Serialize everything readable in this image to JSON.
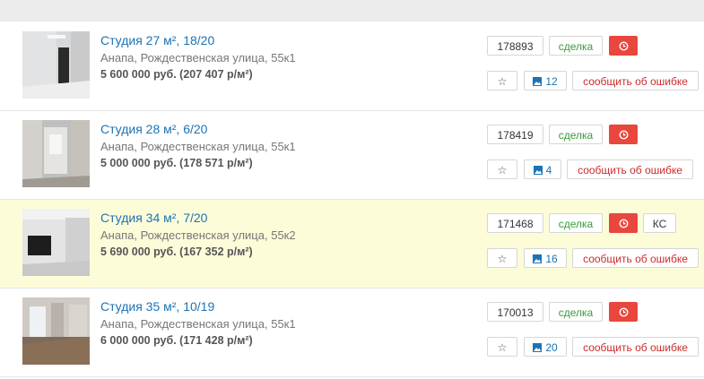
{
  "listings": [
    {
      "title": "Студия 27 м², 18/20",
      "address": "Анапа, Рождественская улица, 55к1",
      "price": "5 600 000 руб. (207 407 р/м²)",
      "id": "178893",
      "status": "сделка",
      "photo_count": "12",
      "report": "сообщить об ошибке"
    },
    {
      "title": "Студия 28 м², 6/20",
      "address": "Анапа, Рождественская улица, 55к1",
      "price": "5 000 000 руб. (178 571 р/м²)",
      "id": "178419",
      "status": "сделка",
      "photo_count": "4",
      "report": "сообщить об ошибке"
    },
    {
      "title": "Студия 34 м², 7/20",
      "address": "Анапа, Рождественская улица, 55к2",
      "price": "5 690 000 руб. (167 352 р/м²)",
      "id": "171468",
      "status": "сделка",
      "tag": "КС",
      "photo_count": "16",
      "report": "сообщить об ошибке"
    },
    {
      "title": "Студия 35 м², 10/19",
      "address": "Анапа, Рождественская улица, 55к1",
      "price": "6 000 000 руб. (171 428 р/м²)",
      "id": "170013",
      "status": "сделка",
      "photo_count": "20",
      "report": "сообщить об ошибке"
    }
  ],
  "icons": {
    "star": "star-icon",
    "photo": "image-icon",
    "clock": "clock-icon"
  },
  "colors": {
    "link": "#1c73b4",
    "status_green": "#3a9b3a",
    "alert_red": "#e9463e",
    "report_red": "#cc2b2b",
    "highlight_row": "#fdfcd9"
  }
}
